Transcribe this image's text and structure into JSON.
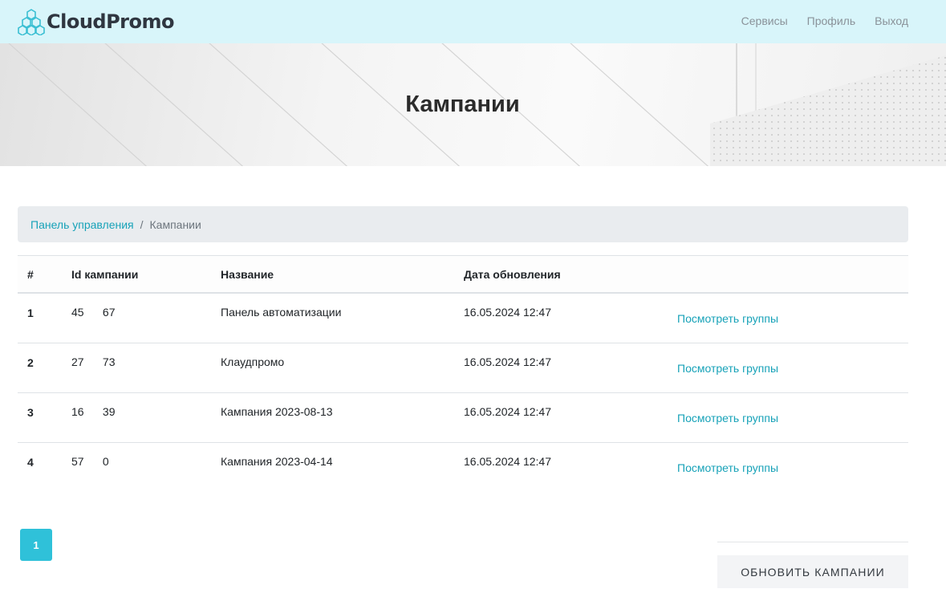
{
  "brand": {
    "name": "CloudPromo",
    "logo": "hexagon-cluster-logo",
    "accent": "#17a2b8"
  },
  "nav": {
    "items": [
      "Сервисы",
      "Профиль",
      "Выход"
    ]
  },
  "hero": {
    "title": "Кампании"
  },
  "breadcrumb": {
    "root": "Панель управления",
    "separator": "/",
    "current": "Кампании"
  },
  "table": {
    "headers": [
      "#",
      "Id кампании",
      "Название",
      "Дата обновления",
      ""
    ],
    "rows": [
      {
        "num": "1",
        "id": "45      67",
        "name": "Панель автоматизации",
        "date": "16.05.2024 12:47",
        "action": "Посмотреть группы"
      },
      {
        "num": "2",
        "id": "27      73",
        "name": "Клаудпромо",
        "date": "16.05.2024 12:47",
        "action": "Посмотреть группы"
      },
      {
        "num": "3",
        "id": "16      39",
        "name": "Кампания 2023-08-13",
        "date": "16.05.2024 12:47",
        "action": "Посмотреть группы"
      },
      {
        "num": "4",
        "id": "57      0",
        "name": "Кампания 2023-04-14",
        "date": "16.05.2024 12:47",
        "action": "Посмотреть группы"
      }
    ]
  },
  "pagination": {
    "current_page": "1"
  },
  "actions": {
    "update_label": "ОБНОВИТЬ КАМПАНИИ"
  }
}
